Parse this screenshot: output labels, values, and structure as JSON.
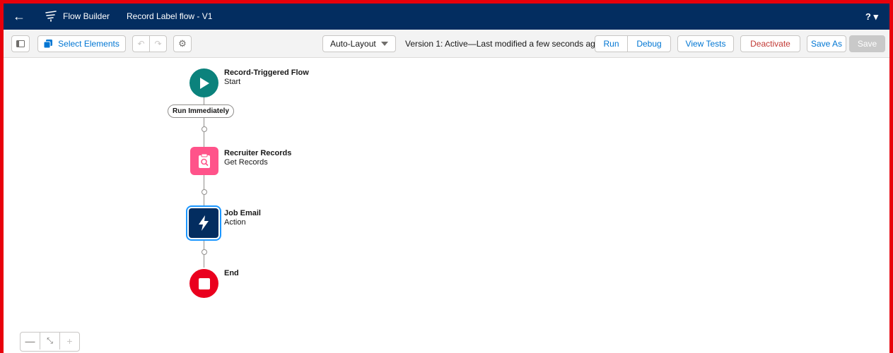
{
  "header": {
    "app_name": "Flow Builder",
    "flow_name": "Record Label flow - V1",
    "help_label": "? ▾"
  },
  "toolbar": {
    "select_elements_label": "Select Elements",
    "layout_select_value": "Auto-Layout",
    "status_text": "Version 1: Active—Last modified a few seconds ago",
    "run_label": "Run",
    "debug_label": "Debug",
    "view_tests_label": "View Tests",
    "deactivate_label": "Deactivate",
    "save_as_label": "Save As",
    "save_label": "Save"
  },
  "flow": {
    "start": {
      "title": "Record-Triggered Flow",
      "subtitle": "Start"
    },
    "path_label": "Run Immediately",
    "get_records": {
      "title": "Recruiter Records",
      "subtitle": "Get Records"
    },
    "action": {
      "title": "Job Email",
      "subtitle": "Action"
    },
    "end": {
      "title": "End"
    }
  },
  "zoom": {
    "out": "—",
    "fit": "⤡",
    "in": "+"
  },
  "colors": {
    "header_bg": "#032d60",
    "start": "#0b827c",
    "get_records": "#ff538a",
    "action": "#032d60",
    "end": "#ea001e",
    "accent": "#0176d3"
  }
}
